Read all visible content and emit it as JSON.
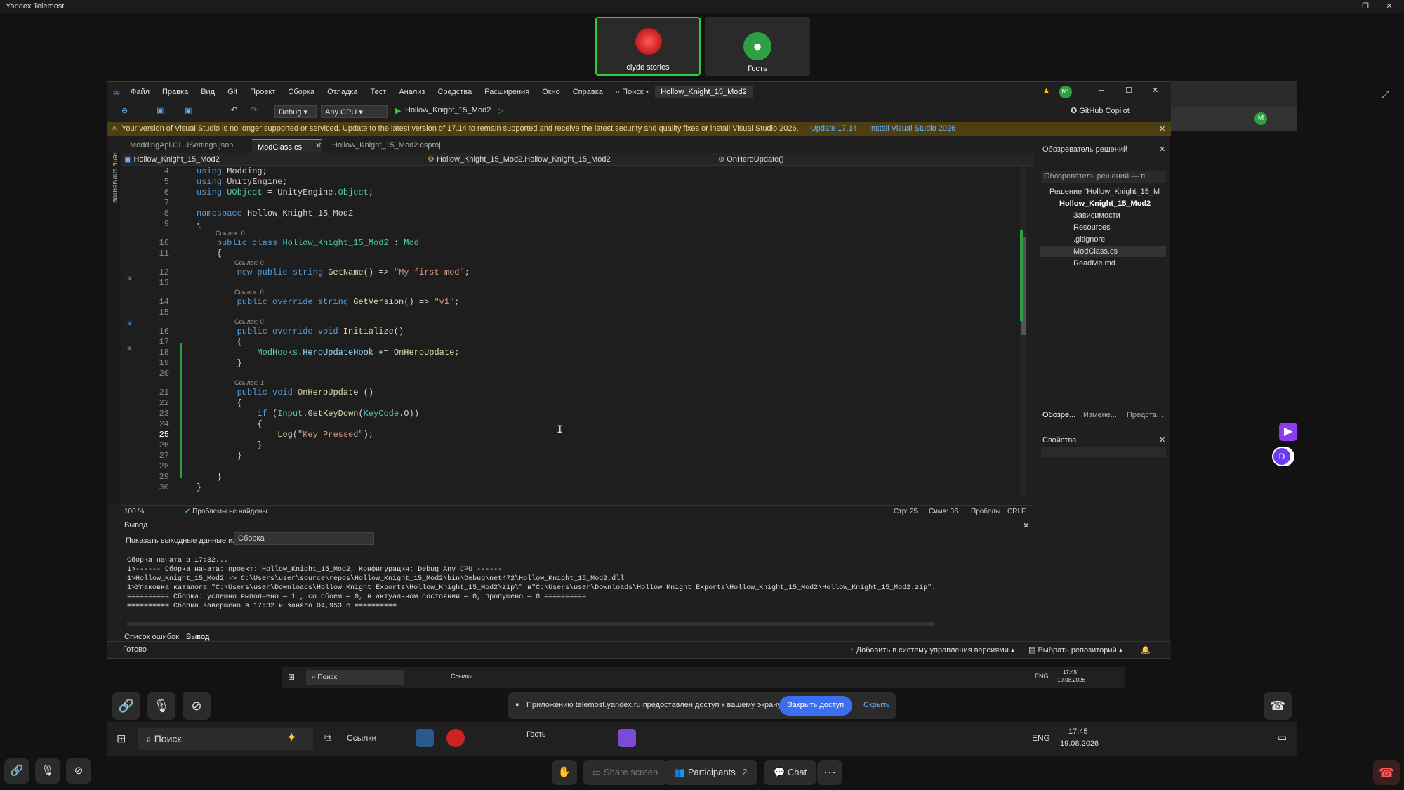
{
  "app": {
    "title": "Yandex Telemost"
  },
  "participants": [
    {
      "name": "clyde stories"
    },
    {
      "name": "Гость"
    }
  ],
  "vs": {
    "menu": [
      "Файл",
      "Правка",
      "Вид",
      "Git",
      "Проект",
      "Сборка",
      "Отладка",
      "Тест",
      "Анализ",
      "Средства",
      "Расширения",
      "Окно",
      "Справка"
    ],
    "search_label": "Поиск",
    "solution_title": "Hollow_Knight_15_Mod2",
    "account_initials": "M1",
    "toolbar": {
      "config": "Debug",
      "platform": "Any CPU",
      "start_target": "Hollow_Knight_15_Mod2",
      "copilot": "GitHub Copilot"
    },
    "infobar": {
      "message": "Your version of Visual Studio is no longer supported or serviced. Update to the latest version of 17.14 to remain supported and receive the latest security and quality fixes or install Visual Studio 2026.",
      "link1": "Update 17.14",
      "link2": "Install Visual Studio 2026"
    },
    "side_panel_label": "Панель элементов",
    "tabs": [
      "ModdingApi.Gl...ISettings.json",
      "ModClass.cs",
      "Hollow_Knight_15_Mod2.csproj"
    ],
    "nav": {
      "project": "Hollow_Knight_15_Mod2",
      "class": "Hollow_Knight_15_Mod2.Hollow_Knight_15_Mod2",
      "member": "OnHeroUpdate()"
    },
    "code": {
      "line_numbers": [
        "4",
        "5",
        "6",
        "7",
        "8",
        "9",
        "10",
        "11",
        "12",
        "13",
        "14",
        "15",
        "16",
        "17",
        "18",
        "19",
        "20",
        "21",
        "22",
        "23",
        "24",
        "25",
        "26",
        "27",
        "28",
        "29",
        "30"
      ],
      "refs": [
        "Ссылок: 0",
        "Ссылок: 0",
        "Ссылок: 0",
        "Ссылок: 0",
        "Ссылок: 1"
      ]
    },
    "status": {
      "zoom": "100 %",
      "problems": "Проблемы не найдены.",
      "line": "Стр: 25",
      "col": "Симв: 36",
      "spaces": "Пробелы",
      "eol": "CRLF"
    },
    "output": {
      "title": "Вывод",
      "show_from_label": "Показать выходные данные из:",
      "source": "Сборка",
      "lines": [
        "Сборка начата в 17:32...",
        "1>------ Сборка начата: проект: Hollow_Knight_15_Mod2, Конфигурация: Debug Any CPU ------",
        "1>Hollow_Knight_15_Mod2 -> C:\\Users\\user\\source\\repos\\Hollow_Knight_15_Mod2\\bin\\Debug\\net472\\Hollow_Knight_15_Mod2.dll",
        "1>Упаковка каталога \"C:\\Users\\user\\Downloads\\Hollow Knight Exports\\Hollow_Knight_15_Mod2\\zip\\\" в\"C:\\Users\\user\\Downloads\\Hollow Knight Exports\\Hollow_Knight_15_Mod2\\Hollow_Knight_15_Mod2.zip\".",
        "========== Сборка: успешно выполнено — 1 , со сбоем — 0, в актуальном состоянии — 0, пропущено — 0 ==========",
        "========== Сборка завершено в 17:32 и заняло 04,953 с =========="
      ],
      "tabs": [
        "Список ошибок",
        "Вывод"
      ]
    },
    "solution_explorer": {
      "title": "Обозреватель решений",
      "search_placeholder": "Обозреватель решений — п",
      "items": [
        "Решение \"Hollow_Knight_15_M",
        "Hollow_Knight_15_Mod2",
        "Зависимости",
        "Resources",
        ".gitignore",
        "ModClass.cs",
        "ReadMe.md"
      ],
      "bottom_tabs": [
        "Обозре...",
        "Измене...",
        "Предста..."
      ]
    },
    "properties": {
      "title": "Свойства"
    },
    "statusbar": {
      "ready": "Готово",
      "vcs": "Добавить в систему управления версиями",
      "repo": "Выбрать репозиторий"
    }
  },
  "inner_taskbar": {
    "search": "Поиск",
    "links": "Ссылки",
    "lang": "ENG",
    "time": "17:45",
    "date": "19.08.2026"
  },
  "share_banner": {
    "message": "Приложению telemost.yandex.ru предоставлен доступ к вашему экрану.",
    "stop": "Закрыть доступ",
    "hide": "Скрыть"
  },
  "taskbar": {
    "search": "Поиск",
    "links": "Ссылки",
    "guest": "Гость",
    "lang": "ENG",
    "time": "17:45",
    "date": "19.08.2026"
  },
  "meeting_bar": {
    "share": "Share screen",
    "participants": "Participants",
    "participants_count": "2",
    "chat": "Chat"
  },
  "side_avatar": "D",
  "colors": {
    "accent": "#9b6bd9",
    "green": "#2ecc40",
    "warn": "#4d3f12"
  }
}
